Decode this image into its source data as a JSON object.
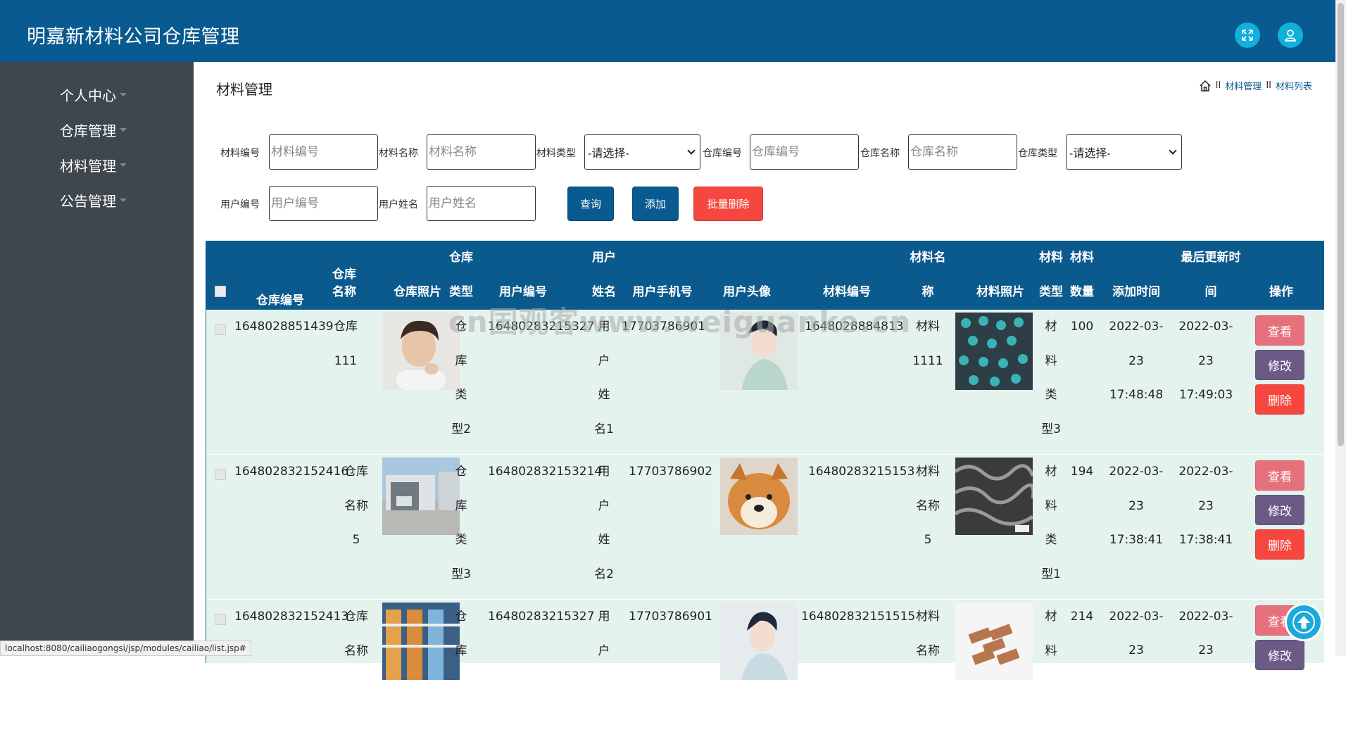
{
  "header": {
    "title": "明嘉新材料公司仓库管理",
    "fullscreen_icon": "expand-icon",
    "user_icon": "user-icon"
  },
  "sidebar": {
    "items": [
      {
        "label": "个人中心"
      },
      {
        "label": "仓库管理"
      },
      {
        "label": "材料管理"
      },
      {
        "label": "公告管理"
      }
    ]
  },
  "page": {
    "title": "材料管理"
  },
  "breadcrumb": {
    "home_icon": "home-icon",
    "sep": "II",
    "items": [
      "材料管理",
      "材料列表"
    ]
  },
  "filters": {
    "material_no_label": "材料编号",
    "material_no_placeholder": "材料编号",
    "material_name_label": "材料名称",
    "material_name_placeholder": "材料名称",
    "material_type_label": "材料类型",
    "material_type_value": "-请选择-",
    "warehouse_no_label": "仓库编号",
    "warehouse_no_placeholder": "仓库编号",
    "warehouse_name_label": "仓库名称",
    "warehouse_name_placeholder": "仓库名称",
    "warehouse_type_label": "仓库类型",
    "warehouse_type_value": "-请选择-",
    "user_no_label": "用户编号",
    "user_no_placeholder": "用户编号",
    "user_name_label": "用户姓名",
    "user_name_placeholder": "用户姓名"
  },
  "buttons": {
    "search": "查询",
    "add": "添加",
    "batch_delete": "批量删除"
  },
  "table": {
    "headers": {
      "warehouse_no": "仓库编号",
      "warehouse_name_1": "仓库",
      "warehouse_name_2": "名称",
      "warehouse_photo": "仓库照片",
      "warehouse_type_1": "仓库",
      "warehouse_type_2": "类型",
      "user_no": "用户编号",
      "user_name_1": "用户",
      "user_name_2": "姓名",
      "user_phone": "用户手机号",
      "user_avatar": "用户头像",
      "material_no": "材料编号",
      "material_name_1": "材料名",
      "material_name_2": "称",
      "material_photo": "材料照片",
      "material_type_1": "材料",
      "material_type_2": "类型",
      "quantity_1": "材料",
      "quantity_2": "数量",
      "added_time": "添加时间",
      "updated_1": "最后更新时",
      "updated_2": "间",
      "actions": "操作"
    },
    "rows": [
      {
        "warehouse_no": "1648028851439",
        "warehouse_name": "仓库111",
        "warehouse_type": "仓库类型2",
        "user_no": "16480283215327",
        "user_name": "用户姓名1",
        "user_phone": "17703786901",
        "material_no": "1648028884813",
        "material_name": "材料1111",
        "material_type": "材料类型3",
        "quantity": "100",
        "added_date": "2022-03-23",
        "added_time": "17:48:48",
        "updated_date": "2022-03-23",
        "updated_time": "17:49:03"
      },
      {
        "warehouse_no": "164802832152416",
        "warehouse_name": "仓库名称5",
        "warehouse_type": "仓库类型3",
        "user_no": "164802832153214",
        "user_name": "用户姓名2",
        "user_phone": "17703786902",
        "material_no": "16480283215153",
        "material_name": "材料名称5",
        "material_type": "材料类型1",
        "quantity": "194",
        "added_date": "2022-03-23",
        "added_time": "17:38:41",
        "updated_date": "2022-03-23",
        "updated_time": "17:38:41"
      },
      {
        "warehouse_no": "164802832152413",
        "warehouse_name": "仓库名称",
        "warehouse_type": "仓库",
        "user_no": "16480283215327",
        "user_name": "用户",
        "user_phone": "17703786901",
        "material_no": "164802832151515",
        "material_name": "材料名称",
        "material_type": "材料",
        "quantity": "214",
        "added_date": "2022-03-",
        "added_time": "23",
        "updated_date": "2022-03-",
        "updated_time": "23"
      }
    ],
    "action_labels": {
      "view": "查看",
      "edit": "修改",
      "delete": "删除"
    }
  },
  "watermark": "cn国观客www.weiguanke.cn",
  "status_url": "localhost:8080/cailiaogongsi/jsp/modules/cailiao/list.jsp#",
  "colors": {
    "header": "#085a90",
    "sidebar": "#3f474e",
    "table_header": "#0b5a8e",
    "row_bg": "#e5f3ef",
    "btn_primary": "#085a90",
    "btn_danger": "#f5473f",
    "btn_view": "#e7707d",
    "btn_edit": "#6c5a86"
  }
}
